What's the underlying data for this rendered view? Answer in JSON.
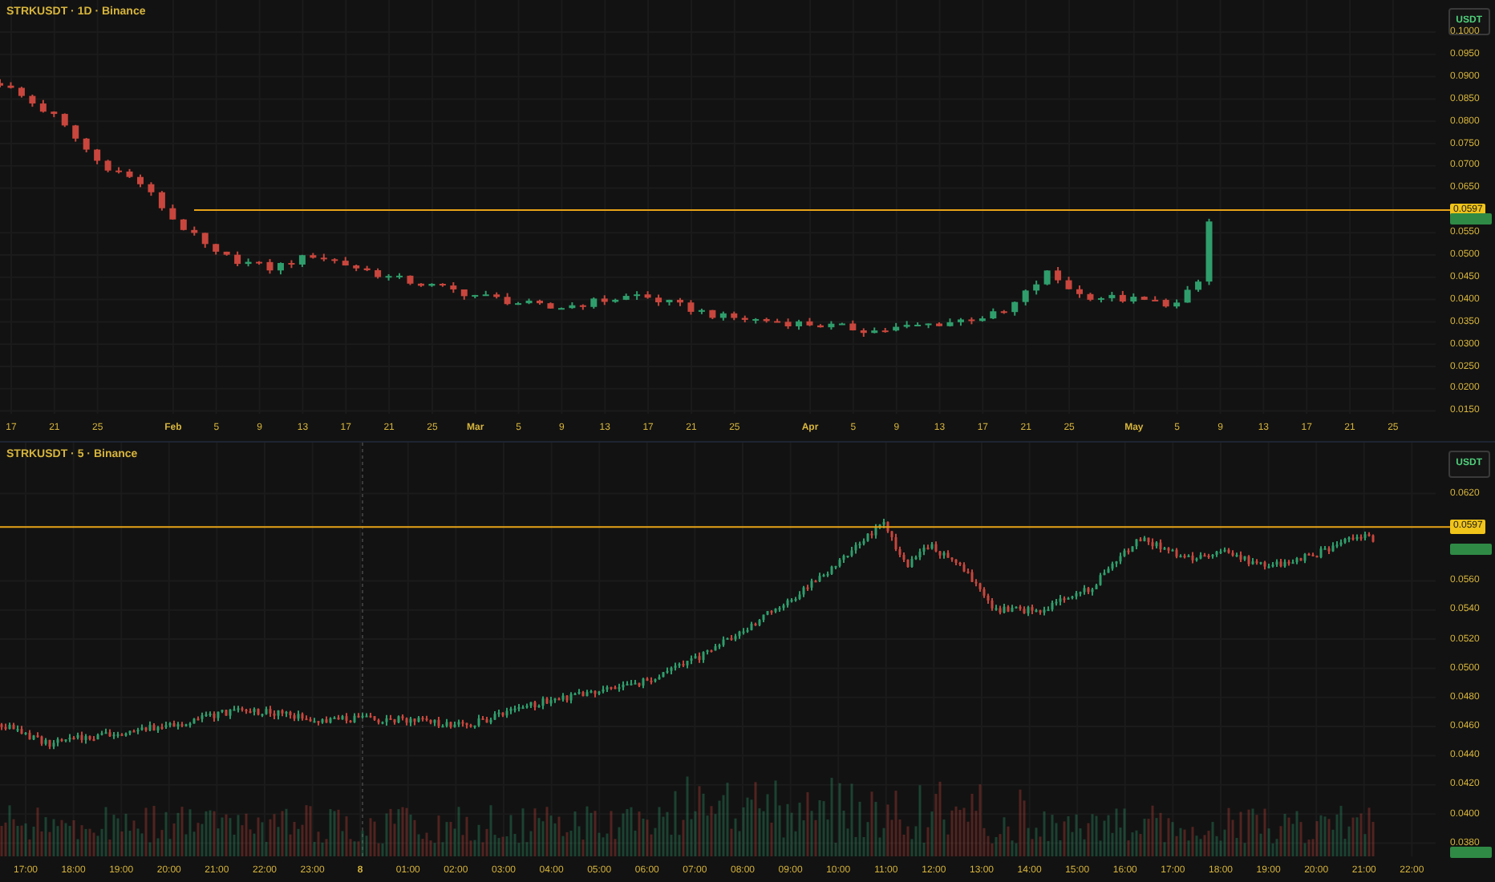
{
  "top_pane": {
    "title": "STRKUSDT · 1D · Binance",
    "currency": "USDT",
    "price_line": "0.0597",
    "y_ticks": [
      "0.1000",
      "0.0950",
      "0.0900",
      "0.0850",
      "0.0800",
      "0.0750",
      "0.0700",
      "0.0650",
      "0.0550",
      "0.0500",
      "0.0450",
      "0.0400",
      "0.0350",
      "0.0300",
      "0.0250",
      "0.0200",
      "0.0150"
    ],
    "x_ticks": [
      {
        "label": "17",
        "kind": "day"
      },
      {
        "label": "21",
        "kind": "day"
      },
      {
        "label": "25",
        "kind": "day"
      },
      {
        "label": "Feb",
        "kind": "month"
      },
      {
        "label": "5",
        "kind": "day"
      },
      {
        "label": "9",
        "kind": "day"
      },
      {
        "label": "13",
        "kind": "day"
      },
      {
        "label": "17",
        "kind": "day"
      },
      {
        "label": "21",
        "kind": "day"
      },
      {
        "label": "25",
        "kind": "day"
      },
      {
        "label": "Mar",
        "kind": "month"
      },
      {
        "label": "5",
        "kind": "day"
      },
      {
        "label": "9",
        "kind": "day"
      },
      {
        "label": "13",
        "kind": "day"
      },
      {
        "label": "17",
        "kind": "day"
      },
      {
        "label": "21",
        "kind": "day"
      },
      {
        "label": "25",
        "kind": "day"
      },
      {
        "label": "Apr",
        "kind": "month"
      },
      {
        "label": "5",
        "kind": "day"
      },
      {
        "label": "9",
        "kind": "day"
      },
      {
        "label": "13",
        "kind": "day"
      },
      {
        "label": "17",
        "kind": "day"
      },
      {
        "label": "21",
        "kind": "day"
      },
      {
        "label": "25",
        "kind": "day"
      },
      {
        "label": "May",
        "kind": "month"
      },
      {
        "label": "5",
        "kind": "day"
      },
      {
        "label": "9",
        "kind": "day"
      },
      {
        "label": "13",
        "kind": "day"
      },
      {
        "label": "17",
        "kind": "day"
      },
      {
        "label": "21",
        "kind": "day"
      },
      {
        "label": "25",
        "kind": "day"
      }
    ]
  },
  "bottom_pane": {
    "title": "STRKUSDT · 5 · Binance",
    "currency": "USDT",
    "price_line": "0.0597",
    "y_ticks": [
      "0.0620",
      "0.0560",
      "0.0540",
      "0.0520",
      "0.0500",
      "0.0480",
      "0.0460",
      "0.0440",
      "0.0420",
      "0.0400",
      "0.0380"
    ],
    "x_ticks": [
      {
        "label": "17:00",
        "kind": "time"
      },
      {
        "label": "18:00",
        "kind": "time"
      },
      {
        "label": "19:00",
        "kind": "time"
      },
      {
        "label": "20:00",
        "kind": "time"
      },
      {
        "label": "21:00",
        "kind": "time"
      },
      {
        "label": "22:00",
        "kind": "time"
      },
      {
        "label": "23:00",
        "kind": "time"
      },
      {
        "label": "8",
        "kind": "day"
      },
      {
        "label": "01:00",
        "kind": "time"
      },
      {
        "label": "02:00",
        "kind": "time"
      },
      {
        "label": "03:00",
        "kind": "time"
      },
      {
        "label": "04:00",
        "kind": "time"
      },
      {
        "label": "05:00",
        "kind": "time"
      },
      {
        "label": "06:00",
        "kind": "time"
      },
      {
        "label": "07:00",
        "kind": "time"
      },
      {
        "label": "08:00",
        "kind": "time"
      },
      {
        "label": "09:00",
        "kind": "time"
      },
      {
        "label": "10:00",
        "kind": "time"
      },
      {
        "label": "11:00",
        "kind": "time"
      },
      {
        "label": "12:00",
        "kind": "time"
      },
      {
        "label": "13:00",
        "kind": "time"
      },
      {
        "label": "14:00",
        "kind": "time"
      },
      {
        "label": "15:00",
        "kind": "time"
      },
      {
        "label": "16:00",
        "kind": "time"
      },
      {
        "label": "17:00",
        "kind": "time"
      },
      {
        "label": "18:00",
        "kind": "time"
      },
      {
        "label": "19:00",
        "kind": "time"
      },
      {
        "label": "20:00",
        "kind": "time"
      },
      {
        "label": "21:00",
        "kind": "time"
      },
      {
        "label": "22:00",
        "kind": "time"
      }
    ]
  }
}
